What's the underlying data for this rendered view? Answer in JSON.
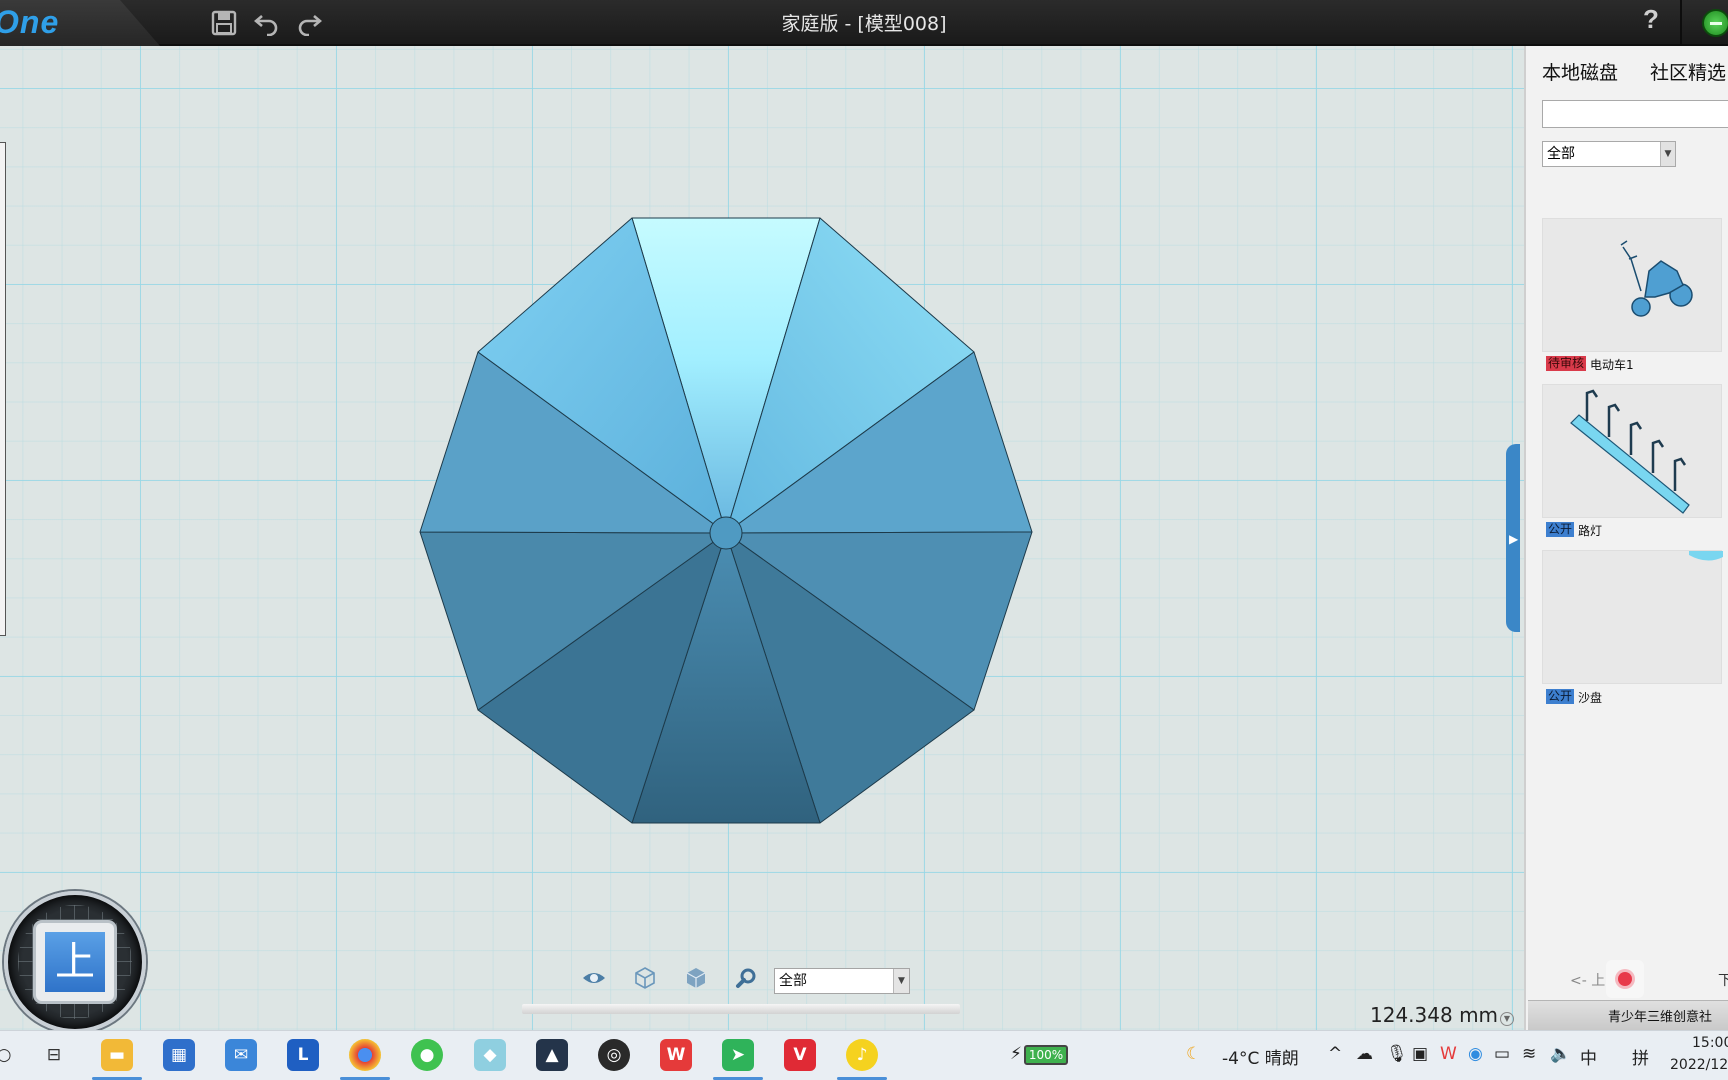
{
  "app": {
    "logo": "One",
    "title": "家庭版 - [模型008]",
    "help_label": "?"
  },
  "toolbar": {
    "save_icon": "save-icon",
    "undo_icon": "undo-icon",
    "redo_icon": "redo-icon"
  },
  "viewport": {
    "view_cube_label": "上",
    "view_filter_value": "全部",
    "measurement": "124.348 mm",
    "model_colors": {
      "light": "#bff6fb",
      "mid": "#5aa6cf",
      "dark": "#2f6c8b"
    }
  },
  "right_panel": {
    "tabs": [
      "本地磁盘",
      "社区精选"
    ],
    "search_placeholder": "",
    "filter_value": "全部",
    "items": [
      {
        "status": "待审核",
        "name": "电动车1"
      },
      {
        "status": "公开",
        "name": "路灯"
      },
      {
        "status": "公开",
        "name": "沙盘"
      }
    ],
    "prev_label": "<- 上",
    "next_label": "下",
    "footer_text": "青少年三维创意社"
  },
  "taskbar": {
    "battery": "100%",
    "weather": "-4°C 晴朗",
    "ime_lang": "中",
    "ime_mode": "拼",
    "time": "15:00",
    "date": "2022/12"
  }
}
